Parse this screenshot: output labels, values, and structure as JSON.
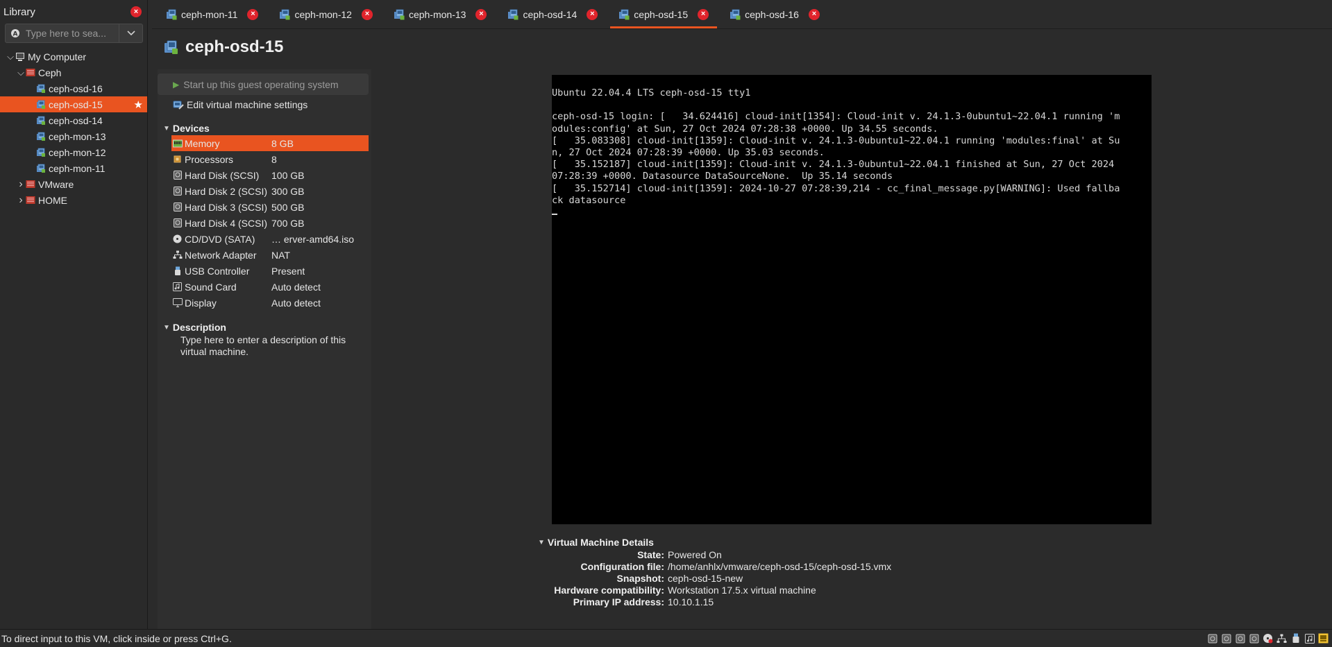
{
  "library": {
    "title": "Library",
    "search_placeholder": "Type here to sea...",
    "tree": [
      {
        "label": "My Computer",
        "level": 0,
        "caret": "down",
        "icon": "computer-icon"
      },
      {
        "label": "Ceph",
        "level": 1,
        "caret": "down",
        "icon": "folder-icon"
      },
      {
        "label": "ceph-osd-16",
        "level": 2,
        "icon": "vm-icon"
      },
      {
        "label": "ceph-osd-15",
        "level": 2,
        "icon": "vm-icon",
        "selected": true
      },
      {
        "label": "ceph-osd-14",
        "level": 2,
        "icon": "vm-icon"
      },
      {
        "label": "ceph-mon-13",
        "level": 2,
        "icon": "vm-icon"
      },
      {
        "label": "ceph-mon-12",
        "level": 2,
        "icon": "vm-icon"
      },
      {
        "label": "ceph-mon-11",
        "level": 2,
        "icon": "vm-icon"
      },
      {
        "label": "VMware",
        "level": 1,
        "caret": "right",
        "icon": "folder-icon"
      },
      {
        "label": "HOME",
        "level": 1,
        "caret": "right",
        "icon": "folder-icon"
      }
    ]
  },
  "tabs": [
    {
      "label": "ceph-mon-11"
    },
    {
      "label": "ceph-mon-12"
    },
    {
      "label": "ceph-mon-13"
    },
    {
      "label": "ceph-osd-14"
    },
    {
      "label": "ceph-osd-15",
      "active": true
    },
    {
      "label": "ceph-osd-16"
    }
  ],
  "vm": {
    "title": "ceph-osd-15",
    "start_label": "Start up this guest operating system",
    "edit_label": "Edit virtual machine settings"
  },
  "devices": {
    "heading": "Devices",
    "items": [
      {
        "name": "Memory",
        "value": "8 GB",
        "icon": "memory-icon",
        "selected": true
      },
      {
        "name": "Processors",
        "value": "8",
        "icon": "processor-icon"
      },
      {
        "name": "Hard Disk (SCSI)",
        "value": "100 GB",
        "icon": "harddisk-icon"
      },
      {
        "name": "Hard Disk 2 (SCSI)",
        "value": "300 GB",
        "icon": "harddisk-icon"
      },
      {
        "name": "Hard Disk 3 (SCSI)",
        "value": "500 GB",
        "icon": "harddisk-icon"
      },
      {
        "name": "Hard Disk 4 (SCSI)",
        "value": "700 GB",
        "icon": "harddisk-icon"
      },
      {
        "name": "CD/DVD (SATA)",
        "value": "… erver-amd64.iso",
        "icon": "cdrom-icon"
      },
      {
        "name": "Network Adapter",
        "value": "NAT",
        "icon": "network-icon"
      },
      {
        "name": "USB Controller",
        "value": "Present",
        "icon": "usb-icon"
      },
      {
        "name": "Sound Card",
        "value": "Auto detect",
        "icon": "sound-icon"
      },
      {
        "name": "Display",
        "value": "Auto detect",
        "icon": "display-icon"
      }
    ]
  },
  "description": {
    "heading": "Description",
    "text": "Type here to enter a description of this virtual machine."
  },
  "console": {
    "lines": [
      "Ubuntu 22.04.4 LTS ceph-osd-15 tty1",
      "",
      "ceph-osd-15 login: [   34.624416] cloud-init[1354]: Cloud-init v. 24.1.3-0ubuntu1~22.04.1 running 'm",
      "odules:config' at Sun, 27 Oct 2024 07:28:38 +0000. Up 34.55 seconds.",
      "[   35.083308] cloud-init[1359]: Cloud-init v. 24.1.3-0ubuntu1~22.04.1 running 'modules:final' at Su",
      "n, 27 Oct 2024 07:28:39 +0000. Up 35.03 seconds.",
      "[   35.152187] cloud-init[1359]: Cloud-init v. 24.1.3-0ubuntu1~22.04.1 finished at Sun, 27 Oct 2024",
      "07:28:39 +0000. Datasource DataSourceNone.  Up 35.14 seconds",
      "[   35.152714] cloud-init[1359]: 2024-10-27 07:28:39,214 - cc_final_message.py[WARNING]: Used fallba",
      "ck datasource"
    ]
  },
  "vm_details": {
    "heading": "Virtual Machine Details",
    "rows": [
      {
        "key": "State:",
        "value": "Powered On"
      },
      {
        "key": "Configuration file:",
        "value": "/home/anhlx/vmware/ceph-osd-15/ceph-osd-15.vmx"
      },
      {
        "key": "Snapshot:",
        "value": "ceph-osd-15-new"
      },
      {
        "key": "Hardware compatibility:",
        "value": "Workstation 17.5.x virtual machine"
      },
      {
        "key": "Primary IP address:",
        "value": "10.10.1.15"
      }
    ]
  },
  "statusbar": {
    "text": "To direct input to this VM, click inside or press Ctrl+G.",
    "icons": [
      "harddisk-status-icon",
      "harddisk-status-icon",
      "harddisk-status-icon",
      "harddisk-status-icon",
      "cdrom-status-icon",
      "network-status-icon",
      "usb-status-icon",
      "sound-status-icon",
      "display-status-icon"
    ]
  },
  "colors": {
    "accent": "#e95420",
    "close": "#e0242c"
  }
}
